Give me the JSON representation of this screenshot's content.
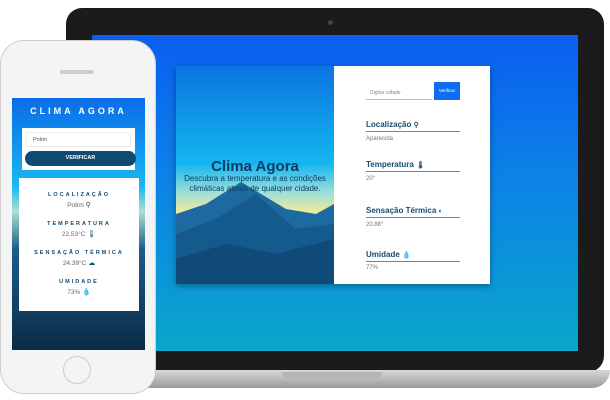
{
  "desktop": {
    "hero_title": "Clima Agora",
    "hero_subtitle": "Descubra a temperatura e as condições climáticas atuais de qualquer cidade.",
    "search_placeholder": "Digitar cidade",
    "verify_button": "Verificar",
    "fields": [
      {
        "label": "Localização",
        "value": "Aparecida",
        "icon": "map-pin-icon"
      },
      {
        "label": "Temperatura",
        "value": "20°",
        "icon": "thermometer-icon"
      },
      {
        "label": "Sensação Térmica",
        "value": "20.88°",
        "icon": "sun-icon"
      },
      {
        "label": "Umidade",
        "value": "77%",
        "icon": "droplet-icon"
      }
    ]
  },
  "mobile": {
    "title": "CLIMA AGORA",
    "search_value": "Potim",
    "verify_button": "VERIFICAR",
    "fields": [
      {
        "label": "LOCALIZAÇÃO",
        "value": "Potim",
        "icon": "map-pin-icon"
      },
      {
        "label": "TEMPERATURA",
        "value": "22.53°C",
        "icon": "thermometer-icon"
      },
      {
        "label": "SENSAÇÃO TÉRMICA",
        "value": "24.39°C",
        "icon": "cloud-icon"
      },
      {
        "label": "UMIDADE",
        "value": "73%",
        "icon": "droplet-icon"
      }
    ]
  },
  "colors": {
    "accent": "#0d6ef2",
    "dark": "#0e4a72"
  }
}
